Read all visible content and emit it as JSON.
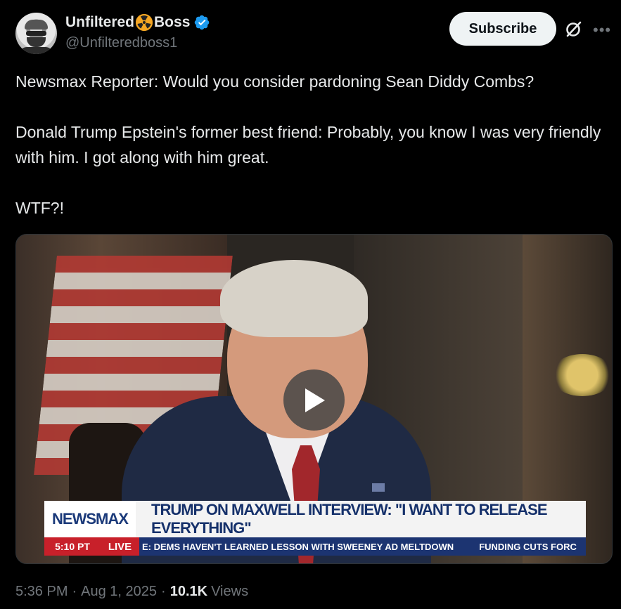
{
  "author": {
    "name_part1": "Unfiltered",
    "name_part2": "Boss",
    "emoji": "radioactive-icon",
    "verified": true,
    "handle": "@Unfilteredboss1"
  },
  "actions": {
    "subscribe_label": "Subscribe",
    "more_label": "•••"
  },
  "tweet": {
    "line1": "Newsmax Reporter: Would you consider pardoning Sean Diddy Combs?",
    "line2": "Donald Trump Epstein's former best friend: Probably, you know I was very friendly with him. I got along with him great.",
    "line3": "WTF?!"
  },
  "video": {
    "brand": "NEWSMAX",
    "headline": "TRUMP ON MAXWELL INTERVIEW: \"I WANT TO RELEASE EVERYTHING\"",
    "time": "5:10 PT",
    "live": "LIVE",
    "ticker1": "E: DEMS HAVEN'T LEARNED LESSON WITH SWEENEY AD MELTDOWN",
    "ticker2": "FUNDING CUTS FORC"
  },
  "meta": {
    "time": "5:36 PM",
    "date": "Aug 1, 2025",
    "views_count": "10.1K",
    "views_label": "Views",
    "separator": "·"
  },
  "colors": {
    "background": "#000000",
    "text": "#e7e9ea",
    "muted": "#71767b",
    "verified": "#1d9bf0",
    "newsmax_red": "#c8202a",
    "newsmax_blue": "#1c3471"
  }
}
